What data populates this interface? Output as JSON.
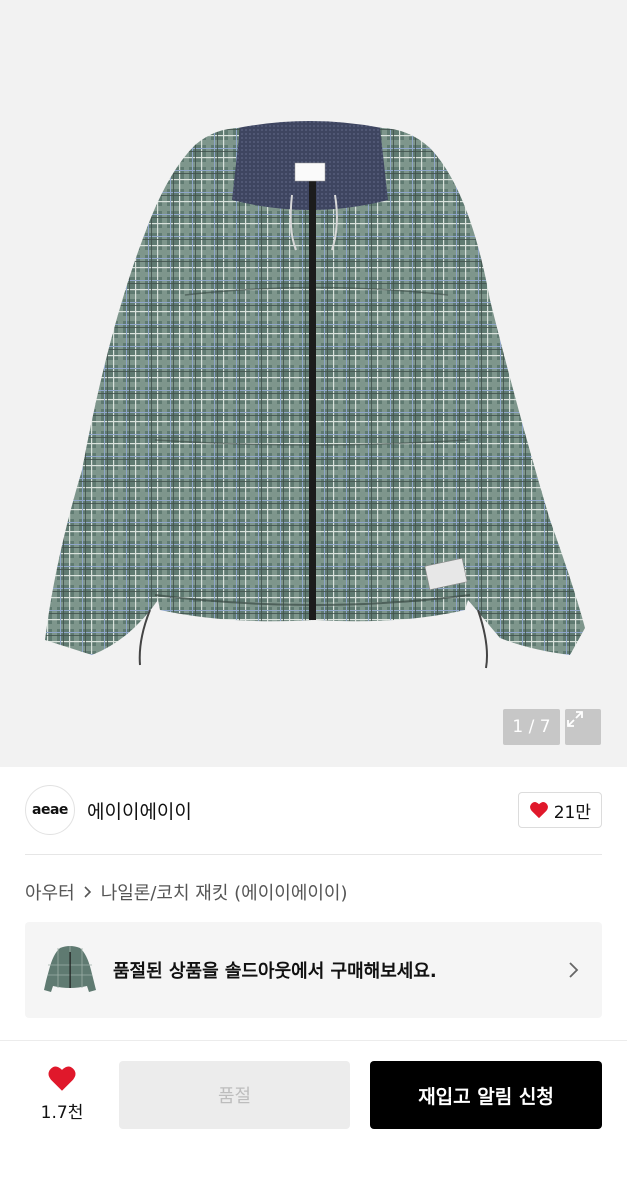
{
  "gallery": {
    "current": "1",
    "separator": "/",
    "total": "7",
    "counter_text": "1 / 7",
    "expand_icon": "expand-arrows-icon",
    "image_subject": "plaid-hooded-jacket"
  },
  "brand": {
    "logo_text": "aeae",
    "name": "에이이에이이",
    "like_count": "21만",
    "heart_color": "#e0182b"
  },
  "breadcrumb": {
    "items": [
      "아우터",
      "나일론/코치 재킷 (에이이에이이)"
    ],
    "separator_icon": "chevron-right-icon"
  },
  "soldout_banner": {
    "text": "품절된 상품을 솔드아웃에서 구매해보세요.",
    "chevron_icon": "chevron-right-icon"
  },
  "bottom_bar": {
    "wish_count": "1.7천",
    "soldout_label": "품절",
    "restock_label": "재입고 알림 신청"
  }
}
